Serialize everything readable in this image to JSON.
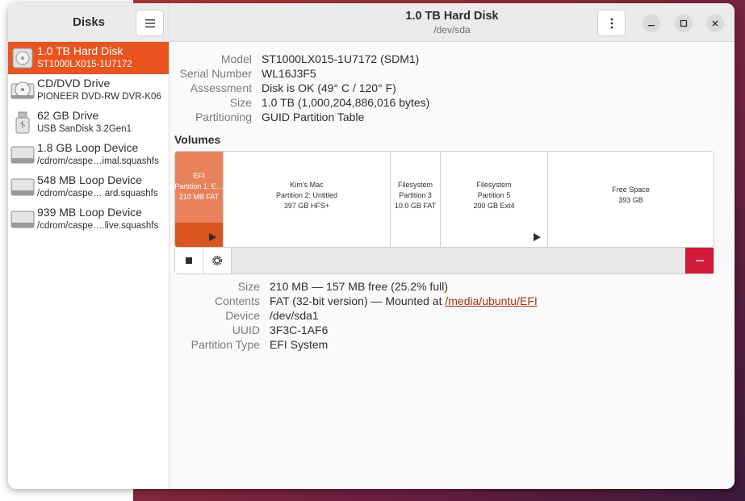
{
  "sidebar": {
    "title": "Disks",
    "items": [
      {
        "name": "1.0 TB Hard Disk",
        "sub": "ST1000LX015-1U7172",
        "icon": "hard-disk-icon",
        "selected": true
      },
      {
        "name": "CD/DVD Drive",
        "sub": "PIONEER DVD-RW  DVR-K06",
        "icon": "optical-drive-icon"
      },
      {
        "name": "62 GB Drive",
        "sub": "USB SanDisk 3.2Gen1",
        "icon": "usb-drive-icon"
      },
      {
        "name": "1.8 GB Loop Device",
        "sub": "/cdrom/caspe…imal.squashfs",
        "icon": "loop-device-icon"
      },
      {
        "name": "548 MB Loop Device",
        "sub": "/cdrom/caspe… ard.squashfs",
        "icon": "loop-device-icon"
      },
      {
        "name": "939 MB Loop Device",
        "sub": "/cdrom/caspe….live.squashfs",
        "icon": "loop-device-icon"
      }
    ]
  },
  "header": {
    "title": "1.0 TB Hard Disk",
    "subtitle": "/dev/sda"
  },
  "drive_info": [
    {
      "label": "Model",
      "value": "ST1000LX015-1U7172 (SDM1)"
    },
    {
      "label": "Serial Number",
      "value": "WL16J3F5"
    },
    {
      "label": "Assessment",
      "value": "Disk is OK (49° C / 120° F)"
    },
    {
      "label": "Size",
      "value": "1.0 TB (1,000,204,886,016 bytes)"
    },
    {
      "label": "Partitioning",
      "value": "GUID Partition Table"
    }
  ],
  "volumes_title": "Volumes",
  "volumes": [
    {
      "lines": [
        "EFI",
        "Partition 1: E…",
        "210 MB FAT"
      ],
      "selected": true,
      "arrow": true
    },
    {
      "lines": [
        "Kim's Mac",
        "Partition 2: Untitled",
        "397 GB HFS+"
      ]
    },
    {
      "lines": [
        "Filesystem",
        "Partition 3",
        "10.0 GB FAT"
      ]
    },
    {
      "lines": [
        "Filesystem",
        "Partition 5",
        "200 GB Ext4"
      ],
      "arrow": true
    },
    {
      "lines": [
        "Free Space",
        "393 GB"
      ]
    }
  ],
  "partition_info": [
    {
      "label": "Size",
      "value": "210 MB — 157 MB free (25.2% full)"
    },
    {
      "label": "Contents",
      "value": "FAT (32-bit version) — Mounted at ",
      "link": "/media/ubuntu/EFI"
    },
    {
      "label": "Device",
      "value": "/dev/sda1"
    },
    {
      "label": "UUID",
      "value": "3F3C-1AF6"
    },
    {
      "label": "Partition Type",
      "value": "EFI System"
    }
  ],
  "colors": {
    "accent": "#e95420",
    "selected_volume": "#e8825d",
    "delete": "#d01b3b"
  }
}
